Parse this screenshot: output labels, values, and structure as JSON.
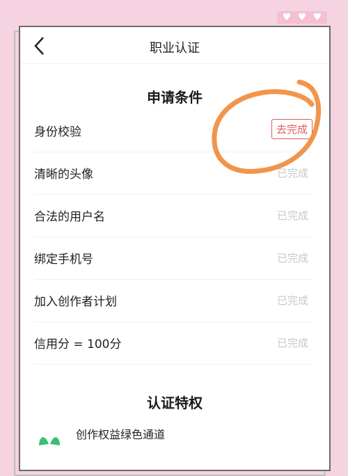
{
  "header": {
    "title": "职业认证"
  },
  "requirements": {
    "title": "申请条件",
    "items": [
      {
        "label": "身份校验",
        "status": "去完成"
      },
      {
        "label": "清晰的头像",
        "status": "已完成"
      },
      {
        "label": "合法的用户名",
        "status": "已完成"
      },
      {
        "label": "绑定手机号",
        "status": "已完成"
      },
      {
        "label": "加入创作者计划",
        "status": "已完成"
      },
      {
        "label": "信用分 = 100分",
        "status": "已完成"
      }
    ]
  },
  "privileges": {
    "title": "认证特权",
    "items": [
      {
        "label": "创作权益绿色通道",
        "icon": "green-leaf-icon"
      }
    ]
  },
  "colors": {
    "accent_red": "#e05a5a",
    "annotation_orange": "#f08a3a",
    "background_pink": "#f6d3e0"
  }
}
